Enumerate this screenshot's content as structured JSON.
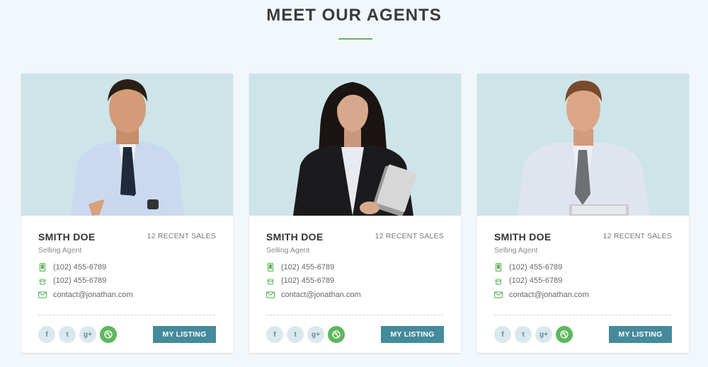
{
  "section": {
    "title": "MEET OUR AGENTS"
  },
  "colors": {
    "accent": "#5cb85c",
    "button": "#438b9b",
    "photo_bg": "#cde4e9"
  },
  "agents": [
    {
      "name": "SMITH DOE",
      "recent_sales": "12 RECENT SALES",
      "role": "Selling Agent",
      "mobile": "(102) 455-6789",
      "phone": "(102) 455-6789",
      "email": "contact@jonathan.com",
      "button_label": "MY LISTING",
      "social": [
        "f",
        "t",
        "g+",
        "dribbble"
      ]
    },
    {
      "name": "SMITH DOE",
      "recent_sales": "12 RECENT SALES",
      "role": "Selling Agent",
      "mobile": "(102) 455-6789",
      "phone": "(102) 455-6789",
      "email": "contact@jonathan.com",
      "button_label": "MY LISTING",
      "social": [
        "f",
        "t",
        "g+",
        "dribbble"
      ]
    },
    {
      "name": "SMITH DOE",
      "recent_sales": "12 RECENT SALES",
      "role": "Selling Agent",
      "mobile": "(102) 455-6789",
      "phone": "(102) 455-6789",
      "email": "contact@jonathan.com",
      "button_label": "MY LISTING",
      "social": [
        "f",
        "t",
        "g+",
        "dribbble"
      ]
    }
  ],
  "icons": {
    "mobile": "mobile-phone-icon",
    "phone": "telephone-icon",
    "email": "envelope-icon",
    "social": [
      "facebook-icon",
      "twitter-icon",
      "google-plus-icon",
      "dribbble-icon"
    ]
  }
}
